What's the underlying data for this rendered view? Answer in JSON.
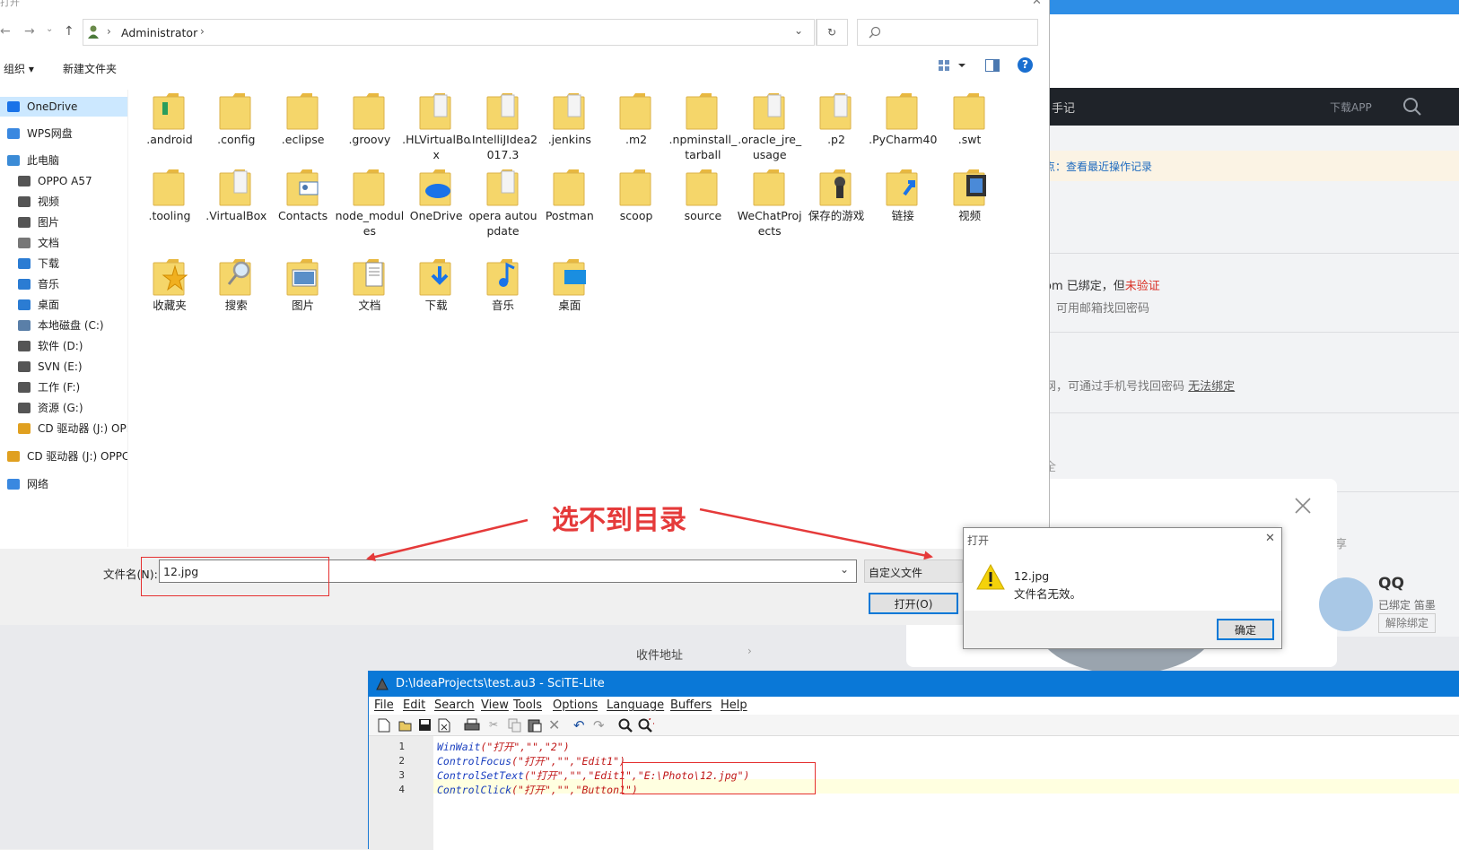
{
  "background_page": {
    "header_nav_item": "手记",
    "download_app": "下载APP",
    "notice_link": "点：查看最近操作记录",
    "email_status_prefix": "om 已绑定，但",
    "email_status_unverified": "未验证",
    "email_hint": "，可用邮箱找回密码",
    "phone_hint_prefix": "网，可通过手机号找回密码",
    "phone_unbind_link": "无法绑定",
    "security_label": "全",
    "qq_title": "QQ",
    "qq_bound_text": "已绑定 笛墨",
    "qq_unbind_button": "解除绑定",
    "address_item": "收件地址",
    "side_char": "享"
  },
  "file_dialog": {
    "title_char": "打开",
    "breadcrumb_user": "Administrator",
    "toolbar": {
      "organize": "组织",
      "new_folder": "新建文件夹"
    },
    "sidebar": [
      {
        "label": "OneDrive",
        "icon": "onedrive-icon",
        "color": "#1a73e8",
        "selected": true
      },
      {
        "label": "WPS网盘",
        "icon": "wps-cloud-icon",
        "color": "#3a88e0"
      },
      {
        "label": "此电脑",
        "icon": "computer-icon",
        "color": "#3b8bd6"
      },
      {
        "label": "OPPO A57",
        "icon": "phone-icon",
        "color": "#555"
      },
      {
        "label": "视频",
        "icon": "video-icon",
        "color": "#555"
      },
      {
        "label": "图片",
        "icon": "picture-icon",
        "color": "#555"
      },
      {
        "label": "文档",
        "icon": "document-icon",
        "color": "#777"
      },
      {
        "label": "下载",
        "icon": "download-icon",
        "color": "#2b7cd3"
      },
      {
        "label": "音乐",
        "icon": "music-icon",
        "color": "#2b7cd3"
      },
      {
        "label": "桌面",
        "icon": "desktop-icon",
        "color": "#2b7cd3"
      },
      {
        "label": "本地磁盘 (C:)",
        "icon": "drive-c-icon",
        "color": "#5a7fa8"
      },
      {
        "label": "软件 (D:)",
        "icon": "drive-icon",
        "color": "#555"
      },
      {
        "label": "SVN (E:)",
        "icon": "drive-icon",
        "color": "#555"
      },
      {
        "label": "工作 (F:)",
        "icon": "drive-icon",
        "color": "#555"
      },
      {
        "label": "资源 (G:)",
        "icon": "drive-icon",
        "color": "#555"
      },
      {
        "label": "CD 驱动器 (J:) OPP",
        "icon": "cd-drive-icon",
        "color": "#e0a020"
      },
      {
        "label": "CD 驱动器 (J:) OPPC",
        "icon": "cd-drive-icon",
        "color": "#e0a020"
      },
      {
        "label": "网络",
        "icon": "network-icon",
        "color": "#3a88e0"
      }
    ],
    "folders": [
      {
        "name": ".android",
        "overlay": "android"
      },
      {
        "name": ".config",
        "overlay": ""
      },
      {
        "name": ".eclipse",
        "overlay": ""
      },
      {
        "name": ".groovy",
        "overlay": ""
      },
      {
        "name": ".HLVirtualBox",
        "overlay": "doc"
      },
      {
        "name": ".IntelliJIdea2017.3",
        "overlay": "doc"
      },
      {
        "name": ".jenkins",
        "overlay": "doc"
      },
      {
        "name": ".m2",
        "overlay": ""
      },
      {
        "name": ".npminstall_tarball",
        "overlay": ""
      },
      {
        "name": ".oracle_jre_usage",
        "overlay": "doc"
      },
      {
        "name": ".p2",
        "overlay": "doc"
      },
      {
        "name": ".PyCharm40",
        "overlay": ""
      },
      {
        "name": ".swt",
        "overlay": ""
      },
      {
        "name": ".tooling",
        "overlay": ""
      },
      {
        "name": ".VirtualBox",
        "overlay": "doc"
      },
      {
        "name": "Contacts",
        "overlay": "contacts"
      },
      {
        "name": "node_modules",
        "overlay": ""
      },
      {
        "name": "OneDrive",
        "overlay": "cloud"
      },
      {
        "name": "opera autoupdate",
        "overlay": "doc"
      },
      {
        "name": "Postman",
        "overlay": ""
      },
      {
        "name": "scoop",
        "overlay": ""
      },
      {
        "name": "source",
        "overlay": ""
      },
      {
        "name": "WeChatProjects",
        "overlay": ""
      },
      {
        "name": "保存的游戏",
        "overlay": "chess"
      },
      {
        "name": "链接",
        "overlay": "link"
      },
      {
        "name": "视频",
        "overlay": "film"
      },
      {
        "name": "收藏夹",
        "overlay": "star"
      },
      {
        "name": "搜索",
        "overlay": "magnifier"
      },
      {
        "name": "图片",
        "overlay": "picture"
      },
      {
        "name": "文档",
        "overlay": "docpage"
      },
      {
        "name": "下载",
        "overlay": "arrow"
      },
      {
        "name": "音乐",
        "overlay": "note"
      },
      {
        "name": "桌面",
        "overlay": "screen"
      }
    ],
    "filename_label": "文件名(N):",
    "filename_value": "12.jpg",
    "filetype_value": "自定义文件",
    "open_button": "打开(O)"
  },
  "annotation": {
    "text": "选不到目录",
    "color": "#e53a3a"
  },
  "message_box": {
    "title": "打开",
    "line1": "12.jpg",
    "line2": "文件名无效。",
    "ok_button": "确定"
  },
  "scite": {
    "title": "D:\\IdeaProjects\\test.au3 - SciTE-Lite",
    "menu": [
      "File",
      "Edit",
      "Search",
      "View",
      "Tools",
      "Options",
      "Language",
      "Buffers",
      "Help"
    ],
    "lines": [
      {
        "num": "1",
        "func": "WinWait",
        "args": "(\"打开\",\"\",\"2\")"
      },
      {
        "num": "2",
        "func": "ControlFocus",
        "args": "(\"打开\",\"\",\"Edit1\")"
      },
      {
        "num": "3",
        "func": "ControlSetText",
        "args": "(\"打开\",\"\",\"Edit1\",\"E:\\Photo\\12.jpg\")"
      },
      {
        "num": "4",
        "func": "ControlClick",
        "args": "(\"打开\",\"\",\"Button1\")"
      }
    ]
  }
}
